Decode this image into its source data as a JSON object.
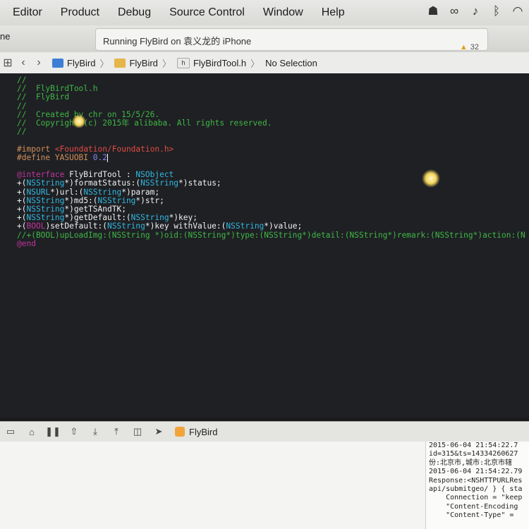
{
  "menubar": {
    "items": [
      "Editor",
      "Product",
      "Debug",
      "Source Control",
      "Window",
      "Help"
    ],
    "status_icons": [
      "robot-icon",
      "glasses-icon",
      "bell-icon",
      "bluetooth-icon",
      "wifi-icon"
    ]
  },
  "toolbar": {
    "scheme_fragment": "ne",
    "activity_text": "Running FlyBird on 袁义龙的 iPhone",
    "warning_count": "32"
  },
  "jumpbar": {
    "crumbs": [
      "FlyBird",
      "FlyBird",
      "FlyBirdTool.h",
      "No Selection"
    ],
    "h_badge": "h"
  },
  "editor": {
    "lines": [
      "//",
      "//  FlyBirdTool.h",
      "//  FlyBird",
      "//",
      "//  Created by chr on 15/5/26.",
      "//  Copyright (c) 2015年 alibaba. All rights reserved.",
      "//",
      "",
      "#import <Foundation/Foundation.h>",
      "#define YASUOBI 0.2",
      "",
      "@interface FlyBirdTool : NSObject",
      "+(NSString*)formatStatus:(NSString*)status;",
      "+(NSURL*)url:(NSString*)param;",
      "+(NSString*)md5:(NSString*)str;",
      "+(NSString*)getTSAndTK;",
      "+(NSString*)getDefault:(NSString*)key;",
      "+(BOOL)setDefault:(NSString*)key withValue:(NSString*)value;",
      "//+(BOOL)upLoadImg:(NSString *)oid:(NSString*)type:(NSString*)detail:(NSString*)remark:(NSString*)action:(N",
      "@end"
    ]
  },
  "debugbar": {
    "target": "FlyBird"
  },
  "console": {
    "lines": [
      "2015-06-04 21:54:22.7",
      "id=315&ts=14334260627",
      "份:北京市,城市:北京市辖",
      "2015-06-04 21:54:22.79",
      "Response:<NSHTTPURLRes",
      "api/submitgeo/ } { sta",
      "    Connection = \"keep",
      "    \"Content-Encoding",
      "    \"Content-Type\" = "
    ]
  }
}
